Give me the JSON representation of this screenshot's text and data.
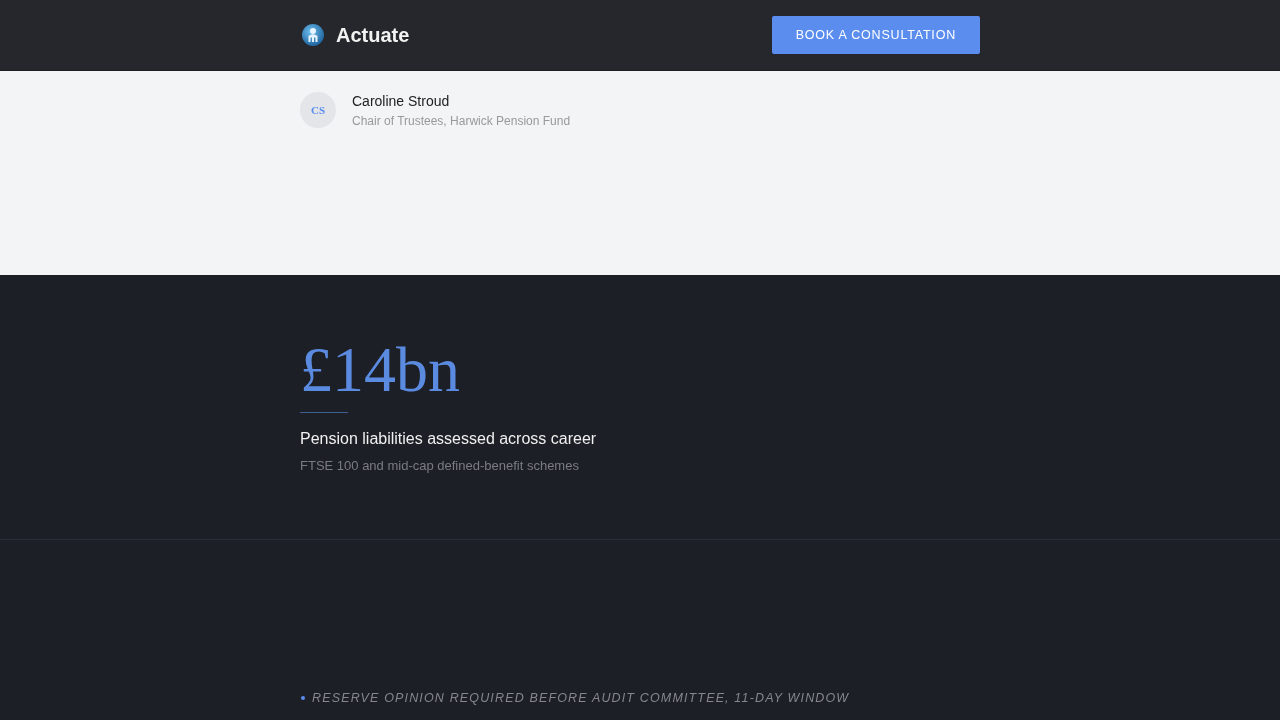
{
  "header": {
    "brand": "Actuate",
    "cta": "BOOK A CONSULTATION"
  },
  "testimonial": {
    "initials": "CS",
    "name": "Caroline Stroud",
    "role": "Chair of Trustees, Harwick Pension Fund"
  },
  "stat": {
    "value": "£14bn",
    "label": "Pension liabilities assessed across career",
    "detail": "FTSE 100 and mid-cap defined-benefit schemes"
  },
  "notice": {
    "text": "RESERVE OPINION REQUIRED BEFORE AUDIT COMMITTEE, 11-DAY WINDOW"
  }
}
